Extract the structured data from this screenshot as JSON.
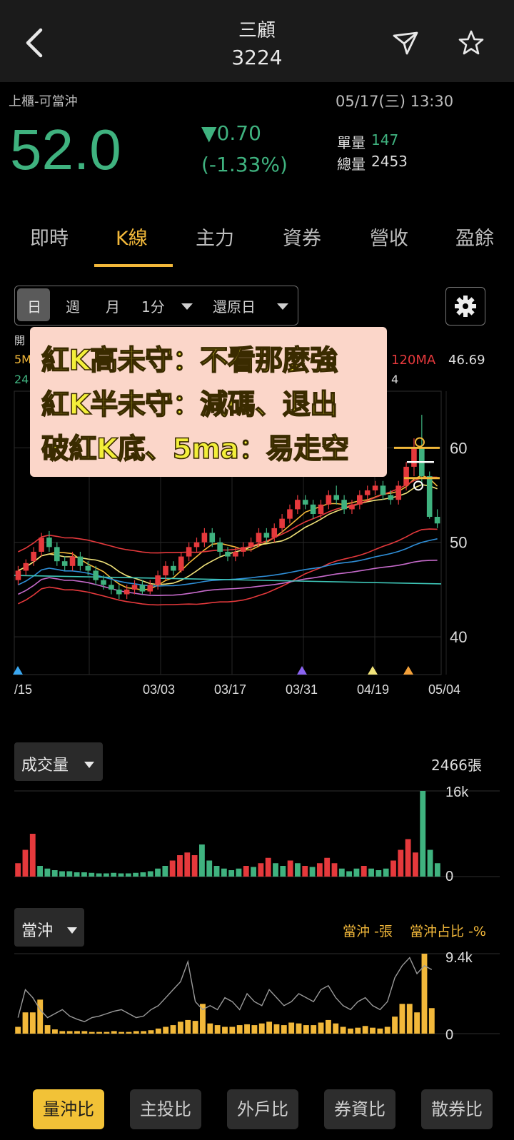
{
  "header": {
    "title": "三顧",
    "code": "3224"
  },
  "quote": {
    "market": "上櫃-可當沖",
    "datetime": "05/17(三) 13:30",
    "price": "52.0",
    "change": "▼0.70",
    "change_pct": "(-1.33%)",
    "unit_vol_label": "單量",
    "unit_vol": "147",
    "total_vol_label": "總量",
    "total_vol": "2453"
  },
  "tabs": [
    {
      "label": "即時"
    },
    {
      "label": "K線"
    },
    {
      "label": "主力"
    },
    {
      "label": "資券"
    },
    {
      "label": "營收"
    },
    {
      "label": "盈餘"
    }
  ],
  "period": {
    "day": "日",
    "week": "週",
    "month": "月",
    "minute": "1分",
    "adjust": "還原日"
  },
  "annotation": {
    "line1": "紅K高未守：不看那麼強",
    "line2": "紅K半未守：減碼、退出",
    "line3": "破紅K底、5ma：易走空"
  },
  "legend": {
    "open_partial": "開",
    "ma5_partial": "5M",
    "row2_partial": "24",
    "ma120_label": "120MA",
    "ma120_value": "46.69",
    "row2_tail": "4"
  },
  "colors": {
    "up": "#e5393c",
    "down": "#3fb27f",
    "accent": "#f2b83a",
    "bg": "#000000"
  },
  "chart_data": [
    {
      "type": "candlestick",
      "title": "",
      "y_ticks": [
        "60",
        "50",
        "40"
      ],
      "ylim": [
        36,
        66
      ],
      "x_ticks": [
        "/15",
        "03/03",
        "03/17",
        "03/31",
        "04/19",
        "05/04"
      ],
      "candles": [
        {
          "o": 46,
          "c": 47,
          "h": 47.5,
          "l": 45.5
        },
        {
          "o": 47,
          "c": 47.8,
          "h": 48.2,
          "l": 46.5
        },
        {
          "o": 48,
          "c": 49,
          "h": 49.5,
          "l": 47.5
        },
        {
          "o": 49,
          "c": 50.5,
          "h": 51,
          "l": 48.5
        },
        {
          "o": 50.5,
          "c": 49.5,
          "h": 51.2,
          "l": 49
        },
        {
          "o": 49.5,
          "c": 48,
          "h": 50,
          "l": 47.5
        },
        {
          "o": 48,
          "c": 47.5,
          "h": 48.5,
          "l": 47
        },
        {
          "o": 47.5,
          "c": 48.5,
          "h": 49,
          "l": 47
        },
        {
          "o": 48.5,
          "c": 47.5,
          "h": 49,
          "l": 47
        },
        {
          "o": 47.5,
          "c": 47,
          "h": 48,
          "l": 46.5
        },
        {
          "o": 47,
          "c": 46,
          "h": 47.5,
          "l": 45.5
        },
        {
          "o": 46,
          "c": 45.5,
          "h": 46.5,
          "l": 45
        },
        {
          "o": 45.5,
          "c": 45,
          "h": 46,
          "l": 44.5
        },
        {
          "o": 45,
          "c": 44.5,
          "h": 45.5,
          "l": 44
        },
        {
          "o": 44.5,
          "c": 45,
          "h": 45.5,
          "l": 44
        },
        {
          "o": 45,
          "c": 45.5,
          "h": 46,
          "l": 44.5
        },
        {
          "o": 45.5,
          "c": 44.8,
          "h": 46,
          "l": 44.5
        },
        {
          "o": 44.8,
          "c": 45.5,
          "h": 46,
          "l": 44.5
        },
        {
          "o": 45.5,
          "c": 46.5,
          "h": 47,
          "l": 45
        },
        {
          "o": 46.5,
          "c": 47.5,
          "h": 48,
          "l": 46
        },
        {
          "o": 47.5,
          "c": 47,
          "h": 48,
          "l": 46.5
        },
        {
          "o": 47,
          "c": 48.5,
          "h": 49,
          "l": 46.8
        },
        {
          "o": 48.5,
          "c": 49.5,
          "h": 50,
          "l": 48
        },
        {
          "o": 49.5,
          "c": 50,
          "h": 50.5,
          "l": 49
        },
        {
          "o": 50,
          "c": 51,
          "h": 51.5,
          "l": 49.5
        },
        {
          "o": 51,
          "c": 50,
          "h": 51.5,
          "l": 49.5
        },
        {
          "o": 50,
          "c": 49,
          "h": 50.5,
          "l": 48.5
        },
        {
          "o": 49,
          "c": 48.5,
          "h": 49.5,
          "l": 48
        },
        {
          "o": 48.5,
          "c": 49,
          "h": 49.5,
          "l": 48
        },
        {
          "o": 49,
          "c": 49.5,
          "h": 50,
          "l": 48.5
        },
        {
          "o": 49.5,
          "c": 50,
          "h": 50.5,
          "l": 49
        },
        {
          "o": 50,
          "c": 51,
          "h": 51.5,
          "l": 49.5
        },
        {
          "o": 51,
          "c": 50.5,
          "h": 51.5,
          "l": 50
        },
        {
          "o": 50.5,
          "c": 51.5,
          "h": 52,
          "l": 50
        },
        {
          "o": 51.5,
          "c": 52.5,
          "h": 53,
          "l": 51
        },
        {
          "o": 52.5,
          "c": 53.5,
          "h": 54,
          "l": 52
        },
        {
          "o": 53.5,
          "c": 54.5,
          "h": 55,
          "l": 53
        },
        {
          "o": 54.5,
          "c": 54,
          "h": 55,
          "l": 53.5
        },
        {
          "o": 54,
          "c": 53,
          "h": 54.5,
          "l": 52.5
        },
        {
          "o": 53,
          "c": 54,
          "h": 54.5,
          "l": 52.5
        },
        {
          "o": 54,
          "c": 55,
          "h": 55.5,
          "l": 53.5
        },
        {
          "o": 55,
          "c": 54.5,
          "h": 56,
          "l": 54
        },
        {
          "o": 54.5,
          "c": 53.5,
          "h": 55,
          "l": 53
        },
        {
          "o": 53.5,
          "c": 54,
          "h": 54.5,
          "l": 53
        },
        {
          "o": 54,
          "c": 55,
          "h": 55.5,
          "l": 53.5
        },
        {
          "o": 55,
          "c": 55.5,
          "h": 56,
          "l": 54.5
        },
        {
          "o": 55.5,
          "c": 56,
          "h": 56.5,
          "l": 55
        },
        {
          "o": 56,
          "c": 55,
          "h": 56.5,
          "l": 54.5
        },
        {
          "o": 55,
          "c": 54.5,
          "h": 55.5,
          "l": 54
        },
        {
          "o": 54.5,
          "c": 56,
          "h": 56.5,
          "l": 54
        },
        {
          "o": 56,
          "c": 58,
          "h": 58.5,
          "l": 55.5
        },
        {
          "o": 58,
          "c": 60,
          "h": 61,
          "l": 57
        },
        {
          "o": 60,
          "c": 57,
          "h": 63.5,
          "l": 56
        },
        {
          "o": 57,
          "c": 52.7,
          "h": 57.5,
          "l": 52.5
        },
        {
          "o": 52.7,
          "c": 52,
          "h": 53.5,
          "l": 51.5
        }
      ]
    },
    {
      "type": "bar",
      "title": "成交量",
      "total_label": "2466張",
      "y_ticks": [
        "16k",
        "0"
      ],
      "ylim": [
        0,
        16
      ],
      "values": [
        2.5,
        5,
        8,
        2,
        1.5,
        1.2,
        1,
        1,
        0.8,
        0.8,
        0.7,
        0.6,
        0.6,
        0.7,
        0.6,
        0.6,
        0.7,
        0.8,
        1,
        1.5,
        2,
        3,
        4,
        4.5,
        4,
        6,
        3,
        2,
        1.5,
        1.2,
        1.5,
        2,
        1.8,
        2.5,
        3.5,
        2.5,
        2,
        3,
        2.5,
        2,
        1.8,
        2.5,
        3.5,
        2.5,
        1.5,
        1,
        1.5,
        2,
        1.5,
        1.2,
        1.5,
        3,
        5,
        7,
        4.5,
        16,
        5,
        2.5
      ],
      "up": [
        1,
        1,
        1,
        0,
        0,
        0,
        0,
        0,
        0,
        0,
        0,
        0,
        0,
        0,
        0,
        0,
        0,
        0,
        0,
        0,
        0,
        1,
        1,
        1,
        1,
        0,
        0,
        0,
        0,
        0,
        0,
        1,
        0,
        1,
        1,
        0,
        0,
        1,
        0,
        1,
        0,
        1,
        1,
        1,
        0,
        0,
        0,
        1,
        0,
        0,
        0,
        1,
        1,
        1,
        1,
        0,
        0,
        0
      ]
    },
    {
      "type": "bar",
      "title": "當沖",
      "legend_day": "當沖 -張",
      "legend_ratio": "當沖占比 -%",
      "y_ticks": [
        "9.4k",
        "0"
      ],
      "ylim": [
        0,
        9.4
      ],
      "values": [
        0.8,
        2.5,
        2.5,
        4,
        1,
        0.5,
        0.3,
        0.3,
        0.3,
        0.3,
        0.2,
        0.2,
        0.2,
        0.3,
        0.2,
        0.2,
        0.3,
        0.3,
        0.4,
        0.6,
        0.8,
        1,
        1.4,
        1.6,
        1.5,
        3.5,
        1.2,
        1,
        0.8,
        0.8,
        1,
        1.1,
        1,
        1.2,
        1.4,
        1.1,
        1,
        1.3,
        1.2,
        1,
        1,
        1.3,
        1.6,
        1.2,
        0.8,
        0.6,
        0.7,
        0.9,
        0.7,
        0.6,
        0.8,
        2,
        3.5,
        3.5,
        2.5,
        9.4,
        3
      ],
      "ratio_line": [
        20,
        55,
        45,
        30,
        20,
        25,
        30,
        22,
        18,
        15,
        20,
        22,
        25,
        28,
        30,
        25,
        20,
        22,
        30,
        35,
        45,
        55,
        65,
        90,
        40,
        30,
        35,
        30,
        45,
        40,
        30,
        50,
        40,
        35,
        55,
        45,
        35,
        40,
        50,
        45,
        40,
        55,
        60,
        45,
        35,
        30,
        40,
        45,
        35,
        30,
        40,
        70,
        85,
        95,
        75,
        85,
        80
      ]
    }
  ],
  "bottom_buttons": [
    {
      "label": "量沖比"
    },
    {
      "label": "主投比"
    },
    {
      "label": "外戶比"
    },
    {
      "label": "券資比"
    },
    {
      "label": "散券比"
    }
  ]
}
